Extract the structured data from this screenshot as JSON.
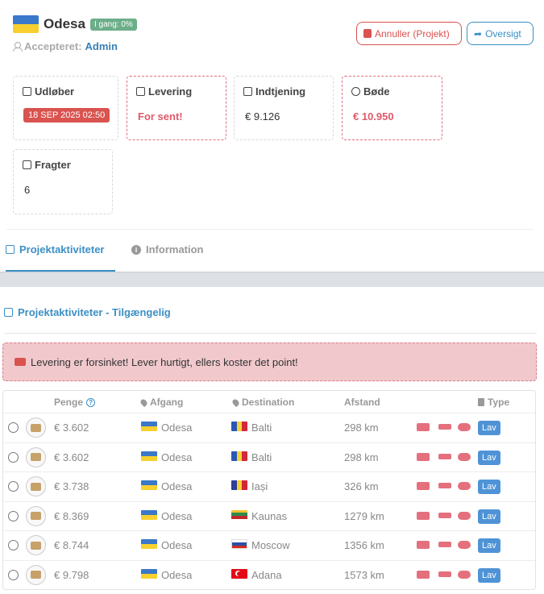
{
  "header": {
    "city": "Odesa",
    "progress_badge": "I gang: 0%",
    "accepted_label": "Accepteret:",
    "accepted_by": "Admin",
    "cancel_button": "Annuller (Projekt)",
    "overview_button": "Oversigt"
  },
  "cards": {
    "expires_label": "Udløber",
    "expires_value": "18 SEP 2025 02:50",
    "delivery_label": "Levering",
    "delivery_value": "For sent!",
    "earnings_label": "Indtjening",
    "earnings_value": "€ 9.126",
    "fine_label": "Bøde",
    "fine_value": "€ 10.950",
    "freight_label": "Fragter",
    "freight_value": "6"
  },
  "tabs": [
    {
      "label": "Projektaktiviteter"
    },
    {
      "label": "Information"
    }
  ],
  "section_title": "Projektaktiviteter - Tilgængelig",
  "alert_text": "Levering er forsinket! Lever hurtigt, ellers koster det point!",
  "table": {
    "headers": {
      "money": "Penge",
      "departure": "Afgang",
      "destination": "Destination",
      "distance": "Afstand",
      "type": "Type"
    },
    "rows": [
      {
        "money": "€ 3.602",
        "from": "Odesa",
        "to": "Balti",
        "to_flag": "md",
        "distance": "298 km",
        "type": "Lav"
      },
      {
        "money": "€ 3.602",
        "from": "Odesa",
        "to": "Balti",
        "to_flag": "md",
        "distance": "298 km",
        "type": "Lav"
      },
      {
        "money": "€ 3.738",
        "from": "Odesa",
        "to": "Iași",
        "to_flag": "ro",
        "distance": "326 km",
        "type": "Lav"
      },
      {
        "money": "€ 8.369",
        "from": "Odesa",
        "to": "Kaunas",
        "to_flag": "lt",
        "distance": "1279 km",
        "type": "Lav"
      },
      {
        "money": "€ 8.744",
        "from": "Odesa",
        "to": "Moscow",
        "to_flag": "ru",
        "distance": "1356 km",
        "type": "Lav"
      },
      {
        "money": "€ 9.798",
        "from": "Odesa",
        "to": "Adana",
        "to_flag": "tr",
        "distance": "1573 km",
        "type": "Lav"
      }
    ]
  },
  "colors": {
    "accent": "#3b8fc4",
    "danger": "#d9534f",
    "success": "#6cae89"
  }
}
